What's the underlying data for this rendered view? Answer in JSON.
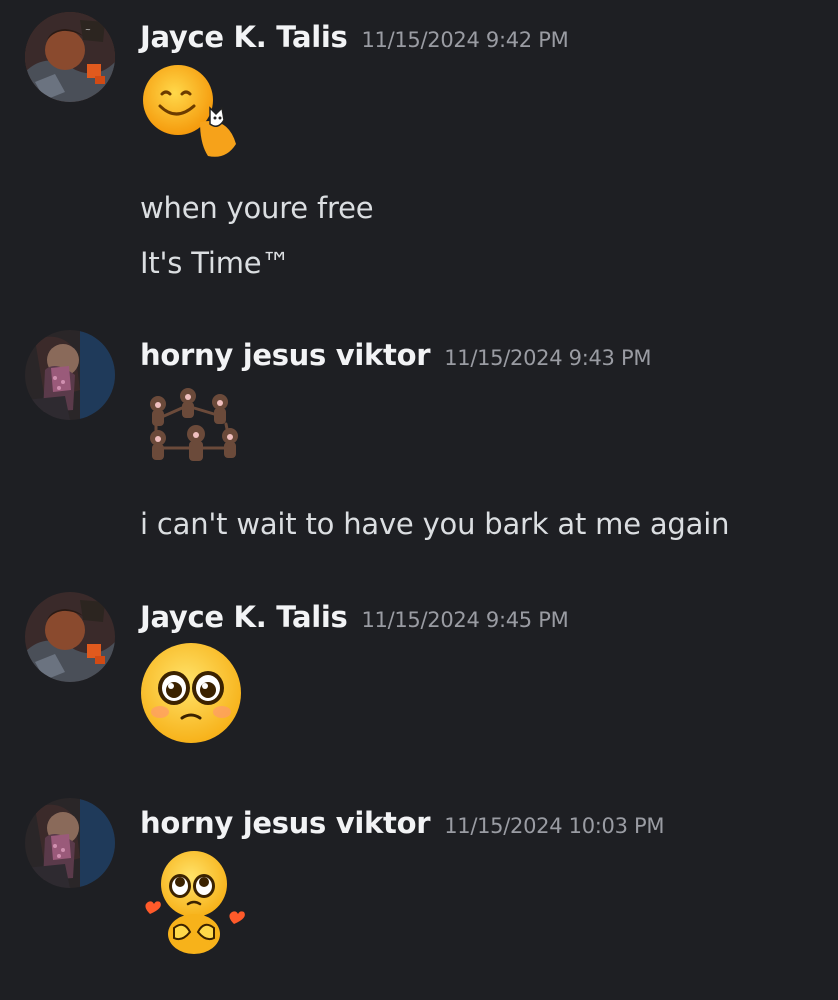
{
  "messages": [
    {
      "username": "Jayce K. Talis",
      "timestamp": "11/15/2024 9:42 PM",
      "emoji": "pat-emoji",
      "lines": [
        "when youre free",
        "It's Time™"
      ]
    },
    {
      "username": "horny jesus viktor",
      "timestamp": "11/15/2024 9:43 PM",
      "emoji": "dancing-monkeys-emoji",
      "lines": [
        "i can't wait to have you bark at me again"
      ]
    },
    {
      "username": "Jayce K. Talis",
      "timestamp": "11/15/2024 9:45 PM",
      "emoji": "pleading-face-emoji",
      "lines": []
    },
    {
      "username": "horny jesus viktor",
      "timestamp": "11/15/2024 10:03 PM",
      "emoji": "shy-pleading-emoji",
      "lines": []
    }
  ],
  "colors": {
    "background": "#1e1f23",
    "username": "#f2f3f5",
    "timestamp": "#9a9ca3",
    "text": "#dbdee1"
  }
}
